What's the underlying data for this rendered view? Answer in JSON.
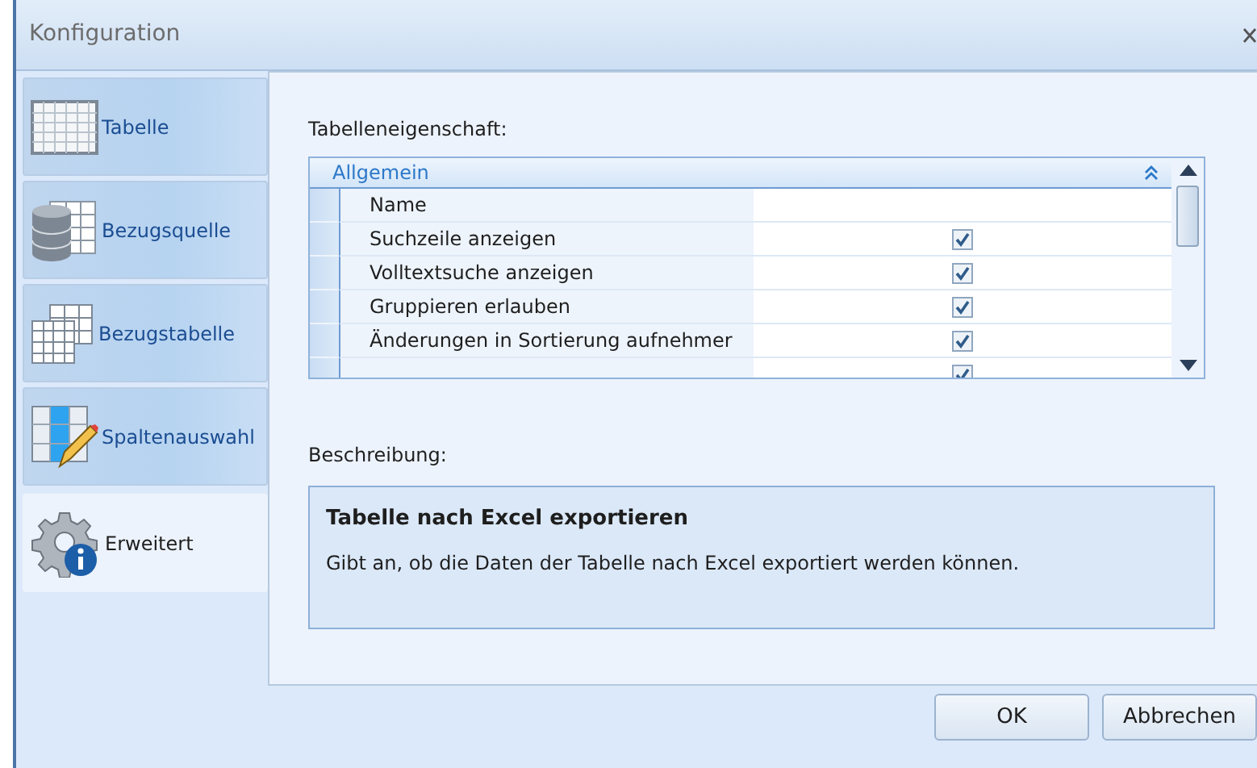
{
  "window": {
    "title": "Konfiguration"
  },
  "tabs": [
    {
      "label": "Tabelle",
      "selected": false
    },
    {
      "label": "Bezugsquelle",
      "selected": false
    },
    {
      "label": "Bezugstabelle",
      "selected": false
    },
    {
      "label": "Spaltenauswahl",
      "selected": false
    },
    {
      "label": "Erweitert",
      "selected": true
    }
  ],
  "property_label": "Tabelleneigenschaft:",
  "property_grid": {
    "category": "Allgemein",
    "expanded": true,
    "rows": [
      {
        "name": "Name",
        "kind": "text"
      },
      {
        "name": "Suchzeile anzeigen",
        "kind": "checkbox",
        "checked": true
      },
      {
        "name": "Volltextsuche anzeigen",
        "kind": "checkbox",
        "checked": true
      },
      {
        "name": "Gruppieren erlauben",
        "kind": "checkbox",
        "checked": true
      },
      {
        "name": "Änderungen in Sortierung aufnehmer",
        "kind": "checkbox",
        "checked": true
      },
      {
        "kind": "checkbox",
        "checked": true
      }
    ]
  },
  "description_label": "Beschreibung:",
  "description": {
    "title": "Tabelle nach Excel exportieren",
    "text": "Gibt an, ob die Daten der Tabelle nach Excel exportiert werden können."
  },
  "buttons": [
    "OK",
    "Abbrechen"
  ]
}
